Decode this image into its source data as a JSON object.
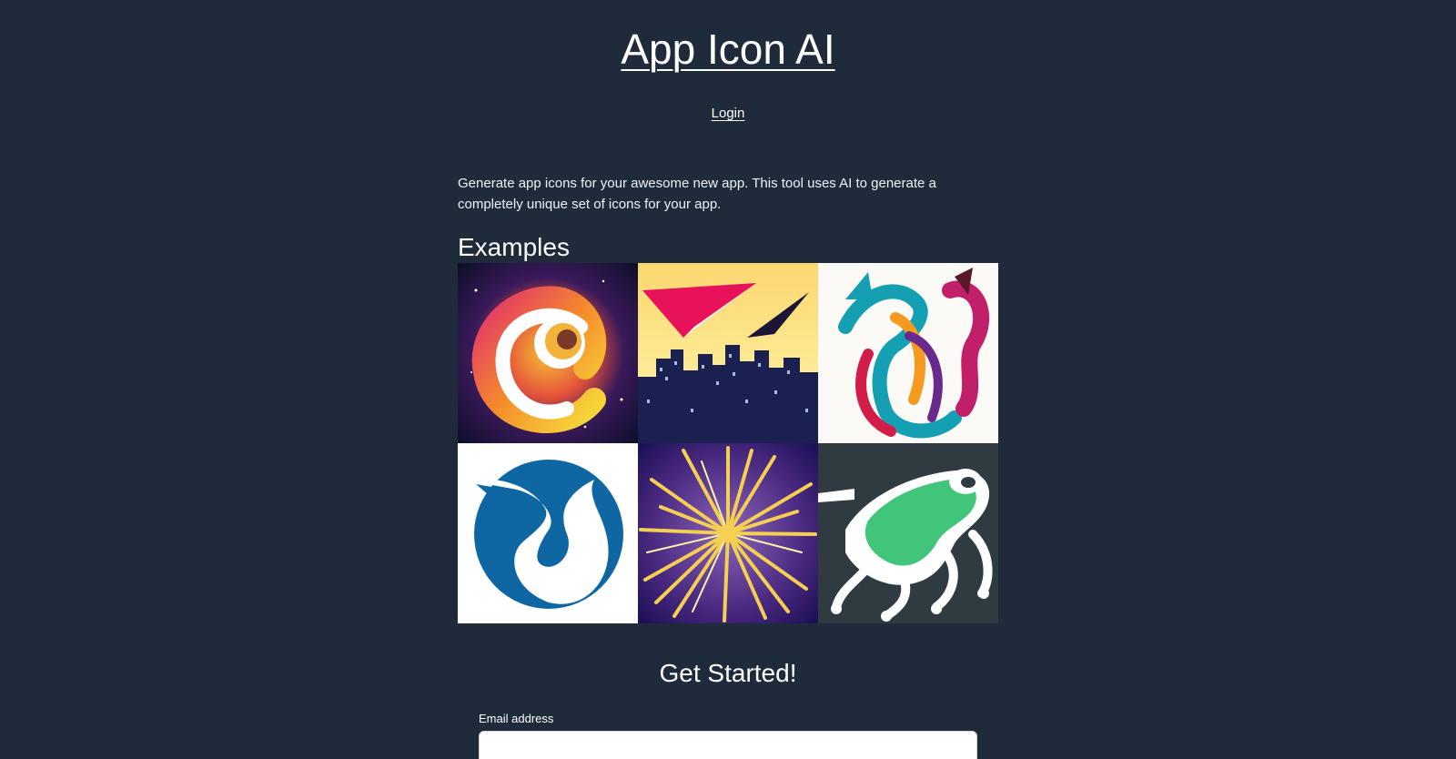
{
  "header": {
    "title": "App Icon AI",
    "login_label": "Login"
  },
  "main": {
    "description": "Generate app icons for your awesome new app. This tool uses AI to generate a completely unique set of icons for your app.",
    "examples_heading": "Examples",
    "examples": [
      {
        "icon": "cosmic-swirl-icon"
      },
      {
        "icon": "paper-plane-city-icon"
      },
      {
        "icon": "abstract-horse-icon"
      },
      {
        "icon": "blue-bird-circle-icon"
      },
      {
        "icon": "firework-burst-icon"
      },
      {
        "icon": "green-frog-icon"
      }
    ]
  },
  "signup": {
    "heading": "Get Started!",
    "email_label": "Email address",
    "email_value": "",
    "email_placeholder": ""
  },
  "colors": {
    "background": "#1f2a3b",
    "text": "#ffffff",
    "input_background": "#ffffff"
  }
}
